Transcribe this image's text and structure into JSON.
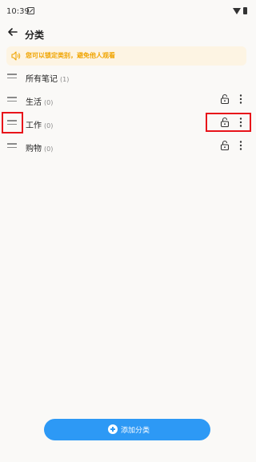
{
  "status_bar": {
    "time": "10:39"
  },
  "header": {
    "title": "分类"
  },
  "notice": {
    "text": "您可以锁定类别，避免他人观看"
  },
  "categories": [
    {
      "name": "所有笔记",
      "count": "(1)"
    },
    {
      "name": "生活",
      "count": "(0)"
    },
    {
      "name": "工作",
      "count": "(0)"
    },
    {
      "name": "购物",
      "count": "(0)"
    }
  ],
  "add_button": {
    "label": "添加分类"
  },
  "colors": {
    "accent": "#2d99f5",
    "notice_text": "#f0a400",
    "notice_bg": "#fdf4e3",
    "highlight": "#e8131a"
  }
}
